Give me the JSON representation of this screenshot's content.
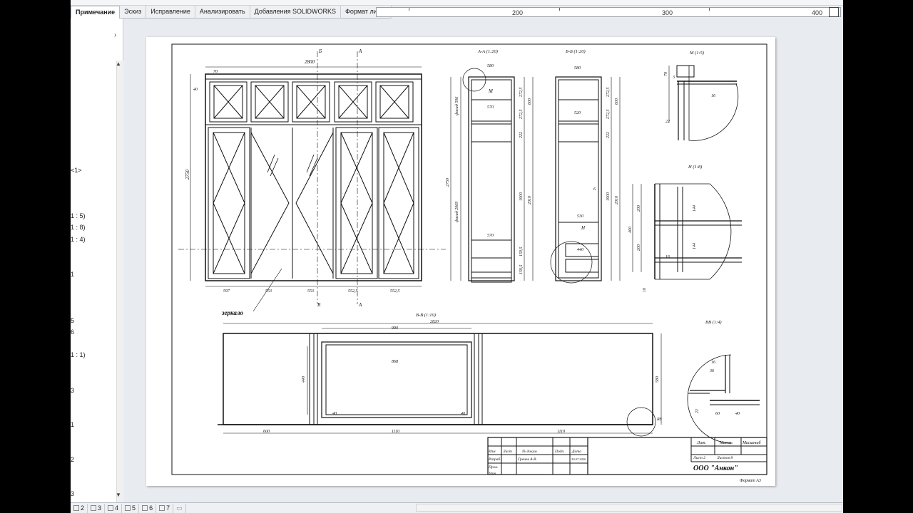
{
  "tabs": [
    "Примечание",
    "Эскиз",
    "Исправление",
    "Анализировать",
    "Добавления SOLIDWORKS",
    "Формат листа"
  ],
  "active_tab": "Примечание",
  "ruler": {
    "marks": [
      "200",
      "300",
      "400"
    ]
  },
  "left_panel": {
    "items": [
      "<1>",
      "1 : 5)",
      "1 : 8)",
      "1 : 4)",
      "1",
      "5",
      "6",
      "1 : 1)",
      "3",
      "1",
      "2",
      "3"
    ]
  },
  "sheet_tabs": [
    "2",
    "3",
    "4",
    "5",
    "6",
    "7"
  ],
  "drawing": {
    "views": {
      "front_width": "2800",
      "front_height": "2750",
      "top_offset": "40",
      "top_mark": "70",
      "bottom_dims": [
        "597",
        "553",
        "553",
        "552,5",
        "552,5"
      ],
      "mirror_label": "зеркало",
      "cut_marks": [
        "А",
        "Б",
        "В",
        "А"
      ],
      "section_aa": {
        "title": "А-А (1:20)",
        "width": "580",
        "shelf": "570",
        "side_top": "фасад 596",
        "side_bottom": "фасад 2069",
        "dims": [
          "272,5",
          "272,5",
          "600",
          "222",
          "1900",
          "2010",
          "159,5",
          "159,5"
        ],
        "inner": "570",
        "callout": "М"
      },
      "section_bb": {
        "title": "Б-Б (1:20)",
        "width": "580",
        "shelf": "520",
        "dims": [
          "272,5",
          "272,5",
          "600",
          "222",
          "1900",
          "2010"
        ],
        "inner": "530",
        "inner2": "440",
        "callout": "Н",
        "panel": "6"
      },
      "detail_m": {
        "title": "М (1:5)",
        "dims": [
          "70",
          "3",
          "16",
          "22"
        ]
      },
      "detail_n": {
        "title": "Н (1:8)",
        "dims": [
          "200",
          "400",
          "200",
          "144",
          "144",
          "16",
          "10"
        ]
      },
      "section_vv": {
        "title": "В-В (1:10)",
        "total": "2820",
        "inner": "990",
        "inner2": "868",
        "depth": "440",
        "side": "580",
        "dims": [
          "600",
          "1110",
          "1110"
        ],
        "small": [
          "40",
          "40"
        ]
      },
      "detail_vv": {
        "title": "ВВ (1:4)",
        "dims": [
          "16",
          "36",
          "22",
          "60",
          "40"
        ],
        "r": "R8"
      }
    },
    "title_block": {
      "headers": [
        "Изм",
        "Лист",
        "№ докум.",
        "Подп.",
        "Дата"
      ],
      "rows": [
        {
          "role": "Разраб.",
          "name": "Грачев А.В.",
          "date": "30.07.2020"
        },
        {
          "role": "Пров.",
          "name": "",
          "date": ""
        },
        {
          "role": "Утв.",
          "name": "",
          "date": ""
        }
      ],
      "lit": "Лит.",
      "mass": "Масса",
      "scale": "Масштаб",
      "sheet_label": "Лист 2",
      "sheets_label": "Листов 8",
      "company": "ООО \"Анкон\"",
      "format": "Формат А3"
    }
  }
}
